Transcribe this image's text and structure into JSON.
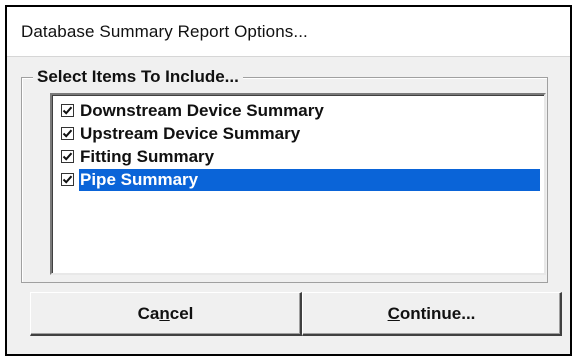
{
  "window": {
    "title": "Database Summary Report Options..."
  },
  "group": {
    "label": "Select Items To Include..."
  },
  "items": [
    {
      "label": "Downstream Device Summary",
      "checked": true,
      "selected": false
    },
    {
      "label": "Upstream Device Summary",
      "checked": true,
      "selected": false
    },
    {
      "label": "Fitting Summary",
      "checked": true,
      "selected": false
    },
    {
      "label": "Pipe Summary",
      "checked": true,
      "selected": true
    }
  ],
  "buttons": {
    "cancel": {
      "before": "Ca",
      "mnemonic": "n",
      "after": "cel"
    },
    "continue": {
      "before": "",
      "mnemonic": "C",
      "after": "ontinue..."
    }
  },
  "colors": {
    "selection": "#0a64d8",
    "face": "#f0f0f0"
  }
}
